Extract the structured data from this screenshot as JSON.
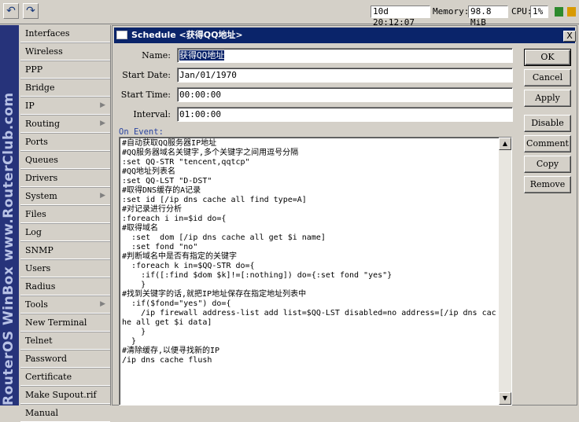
{
  "toolbar": {
    "undo_icon": "undo-icon",
    "redo_icon": "redo-icon",
    "uptime": "10d 20:12:07",
    "memory_label": "Memory:",
    "memory_value": "98.8 MiB",
    "cpu_label": "CPU:",
    "cpu_value": "1%",
    "colors": {
      "cpu_led": "#2d8a2d",
      "lock_led": "#d89a00"
    }
  },
  "brand": {
    "text": "RouterOS WinBox   www.RouterClub.com"
  },
  "menu": {
    "items": [
      {
        "label": "Interfaces"
      },
      {
        "label": "Wireless"
      },
      {
        "label": "PPP"
      },
      {
        "label": "Bridge"
      },
      {
        "label": "IP"
      },
      {
        "label": "Routing"
      },
      {
        "label": "Ports"
      },
      {
        "label": "Queues"
      },
      {
        "label": "Drivers"
      },
      {
        "label": "System"
      },
      {
        "label": "Files"
      },
      {
        "label": "Log"
      },
      {
        "label": "SNMP"
      },
      {
        "label": "Users"
      },
      {
        "label": "Radius"
      },
      {
        "label": "Tools"
      },
      {
        "label": "New Terminal"
      },
      {
        "label": "Telnet"
      },
      {
        "label": "Password"
      },
      {
        "label": "Certificate"
      },
      {
        "label": "Make Supout.rif"
      },
      {
        "label": "Manual"
      }
    ]
  },
  "dialog": {
    "title": "Schedule <获得QQ地址>",
    "close_label": "X",
    "fields": {
      "name_label": "Name:",
      "name_value": "获得QQ地址",
      "start_date_label": "Start Date:",
      "start_date_value": "Jan/01/1970",
      "start_time_label": "Start Time:",
      "start_time_value": "00:00:00",
      "interval_label": "Interval:",
      "interval_value": "01:00:00"
    },
    "on_event_label": "On Event:",
    "on_event": "#自动获取QQ服务器IP地址\n#QQ服务器域名关键字,多个关键字之间用逗号分隔\n:set QQ-STR \"tencent,qqtcp\"\n#QQ地址列表名\n:set QQ-LST \"D-DST\"\n#取得DNS缓存的A记录\n:set id [/ip dns cache all find type=A]\n#对记录进行分析\n:foreach i in=$id do={\n#取得域名\n  :set  dom [/ip dns cache all get $i name]\n  :set fond \"no\"\n#判断域名中是否有指定的关键字\n  :foreach k in=$QQ-STR do={\n    :if([:find $dom $k]!=[:nothing]) do={:set fond \"yes\"}\n    }\n#找到关键字的话,就把IP地址保存在指定地址列表中\n  :if($fond=\"yes\") do={\n    /ip firewall address-list add list=$QQ-LST disabled=no address=[/ip dns cache all get $i data]\n    }\n  }\n#清除缓存,以便寻找新的IP\n/ip dns cache flush",
    "buttons": {
      "ok": "OK",
      "cancel": "Cancel",
      "apply": "Apply",
      "disable": "Disable",
      "comment": "Comment",
      "copy": "Copy",
      "remove": "Remove"
    }
  }
}
